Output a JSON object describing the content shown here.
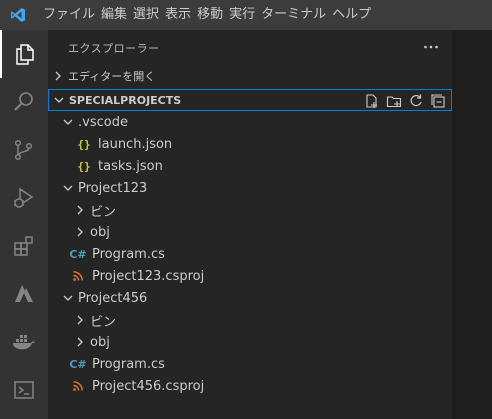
{
  "menu": [
    "ファイル",
    "編集",
    "選択",
    "表示",
    "移動",
    "実行",
    "ターミナル",
    "ヘルプ"
  ],
  "sidebar": {
    "title": "エクスプローラー",
    "more_icon": "ellipsis-icon"
  },
  "sections": {
    "open_editors": "エディターを開く",
    "root": "SPECIALPROJECTS"
  },
  "root_actions": [
    "new-file-icon",
    "new-folder-icon",
    "refresh-icon",
    "collapse-all-icon"
  ],
  "tree": [
    {
      "label": ".vscode",
      "type": "folder",
      "expanded": true
    },
    {
      "label": "launch.json",
      "type": "json"
    },
    {
      "label": "tasks.json",
      "type": "json"
    },
    {
      "label": "Project123",
      "type": "folder",
      "expanded": true
    },
    {
      "label": "ビン",
      "type": "folder",
      "expanded": false
    },
    {
      "label": "obj",
      "type": "folder",
      "expanded": false
    },
    {
      "label": "Program.cs",
      "type": "cs"
    },
    {
      "label": "Project123.csproj",
      "type": "csproj"
    },
    {
      "label": "Project456",
      "type": "folder",
      "expanded": true
    },
    {
      "label": "ビン",
      "type": "folder",
      "expanded": false
    },
    {
      "label": "obj",
      "type": "folder",
      "expanded": false
    },
    {
      "label": "Program.cs",
      "type": "cs"
    },
    {
      "label": "Project456.csproj",
      "type": "csproj"
    }
  ],
  "activity": [
    "files-icon",
    "search-icon",
    "source-control-icon",
    "run-debug-icon",
    "extensions-icon",
    "azure-icon",
    "docker-icon",
    "terminal-icon"
  ],
  "colors": {
    "accent": "#007fd4",
    "json": "#cbcb41",
    "cs": "#519aba",
    "csproj": "#e37933"
  }
}
